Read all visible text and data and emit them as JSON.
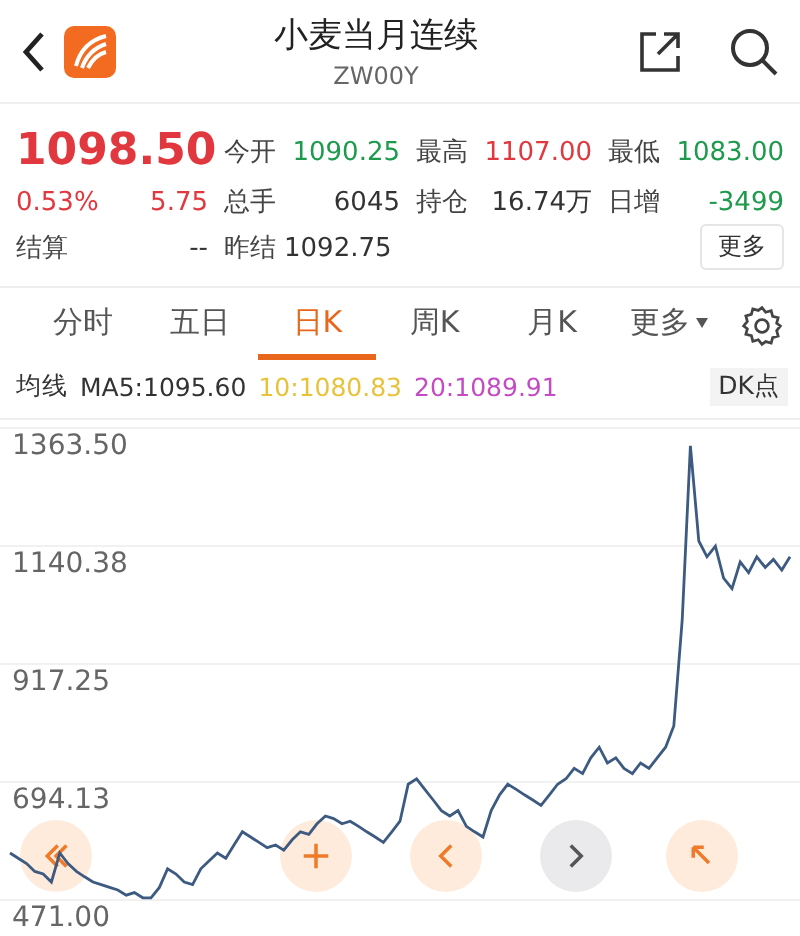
{
  "header": {
    "title": "小麦当月连续",
    "code": "ZW00Y"
  },
  "quote": {
    "price": "1098.50",
    "change_pct": "0.53%",
    "change": "5.75",
    "color": "#e0383e",
    "stats": [
      {
        "label": "今开",
        "value": "1090.25",
        "color": "#1d9a4c"
      },
      {
        "label": "最高",
        "value": "1107.00",
        "color": "#e0383e"
      },
      {
        "label": "最低",
        "value": "1083.00",
        "color": "#1d9a4c"
      },
      {
        "label": "总手",
        "value": "6045",
        "color": "#333333"
      },
      {
        "label": "持仓",
        "value": "16.74万",
        "color": "#333333"
      },
      {
        "label": "日增",
        "value": "-3499",
        "color": "#1d9a4c"
      }
    ],
    "settle_label": "结算",
    "settle_value": "--",
    "prev_label": "昨结",
    "prev_value": "1092.75",
    "more": "更多"
  },
  "tabs": [
    {
      "label": "分时",
      "selected": false
    },
    {
      "label": "五日",
      "selected": false
    },
    {
      "label": "日K",
      "selected": true
    },
    {
      "label": "周K",
      "selected": false
    },
    {
      "label": "月K",
      "selected": false
    },
    {
      "label": "更多",
      "selected": false,
      "kind": "dropdown"
    }
  ],
  "indicators": {
    "label": "均线",
    "items": [
      {
        "text": "MA5:1095.60",
        "color": "#333333"
      },
      {
        "text": "10:1080.83",
        "color": "#e8c23a"
      },
      {
        "text": "20:1089.91",
        "color": "#c44bc4"
      }
    ],
    "dk": "DK点"
  },
  "chart_data": {
    "type": "line",
    "grid": true,
    "ylim": [
      471,
      1363.5
    ],
    "yticks": [
      {
        "value": 1363.5,
        "label": "1363.50"
      },
      {
        "value": 1140.38,
        "label": "1140.38"
      },
      {
        "value": 917.25,
        "label": "917.25"
      },
      {
        "value": 694.13,
        "label": "694.13"
      },
      {
        "value": 471,
        "label": "471.00"
      }
    ],
    "series": [
      {
        "color": "#3d5a80",
        "values": [
          560,
          550,
          540,
          525,
          520,
          505,
          560,
          540,
          525,
          515,
          505,
          500,
          495,
          490,
          480,
          485,
          475,
          475,
          495,
          530,
          520,
          505,
          500,
          530,
          545,
          560,
          550,
          575,
          600,
          590,
          580,
          570,
          575,
          565,
          585,
          600,
          595,
          615,
          630,
          625,
          615,
          620,
          610,
          600,
          590,
          580,
          600,
          620,
          690,
          700,
          680,
          660,
          640,
          630,
          640,
          610,
          600,
          590,
          640,
          670,
          690,
          680,
          670,
          660,
          650,
          670,
          690,
          700,
          720,
          710,
          740,
          760,
          730,
          740,
          720,
          710,
          730,
          720,
          740,
          760,
          800,
          1000,
          1330,
          1150,
          1120,
          1140,
          1080,
          1060,
          1110,
          1090,
          1120,
          1100,
          1115,
          1095,
          1120
        ]
      }
    ]
  },
  "chart_controls": [
    {
      "kind": "first"
    },
    {
      "kind": "zoom_in"
    },
    {
      "kind": "prev"
    },
    {
      "kind": "next"
    },
    {
      "kind": "expand"
    }
  ]
}
